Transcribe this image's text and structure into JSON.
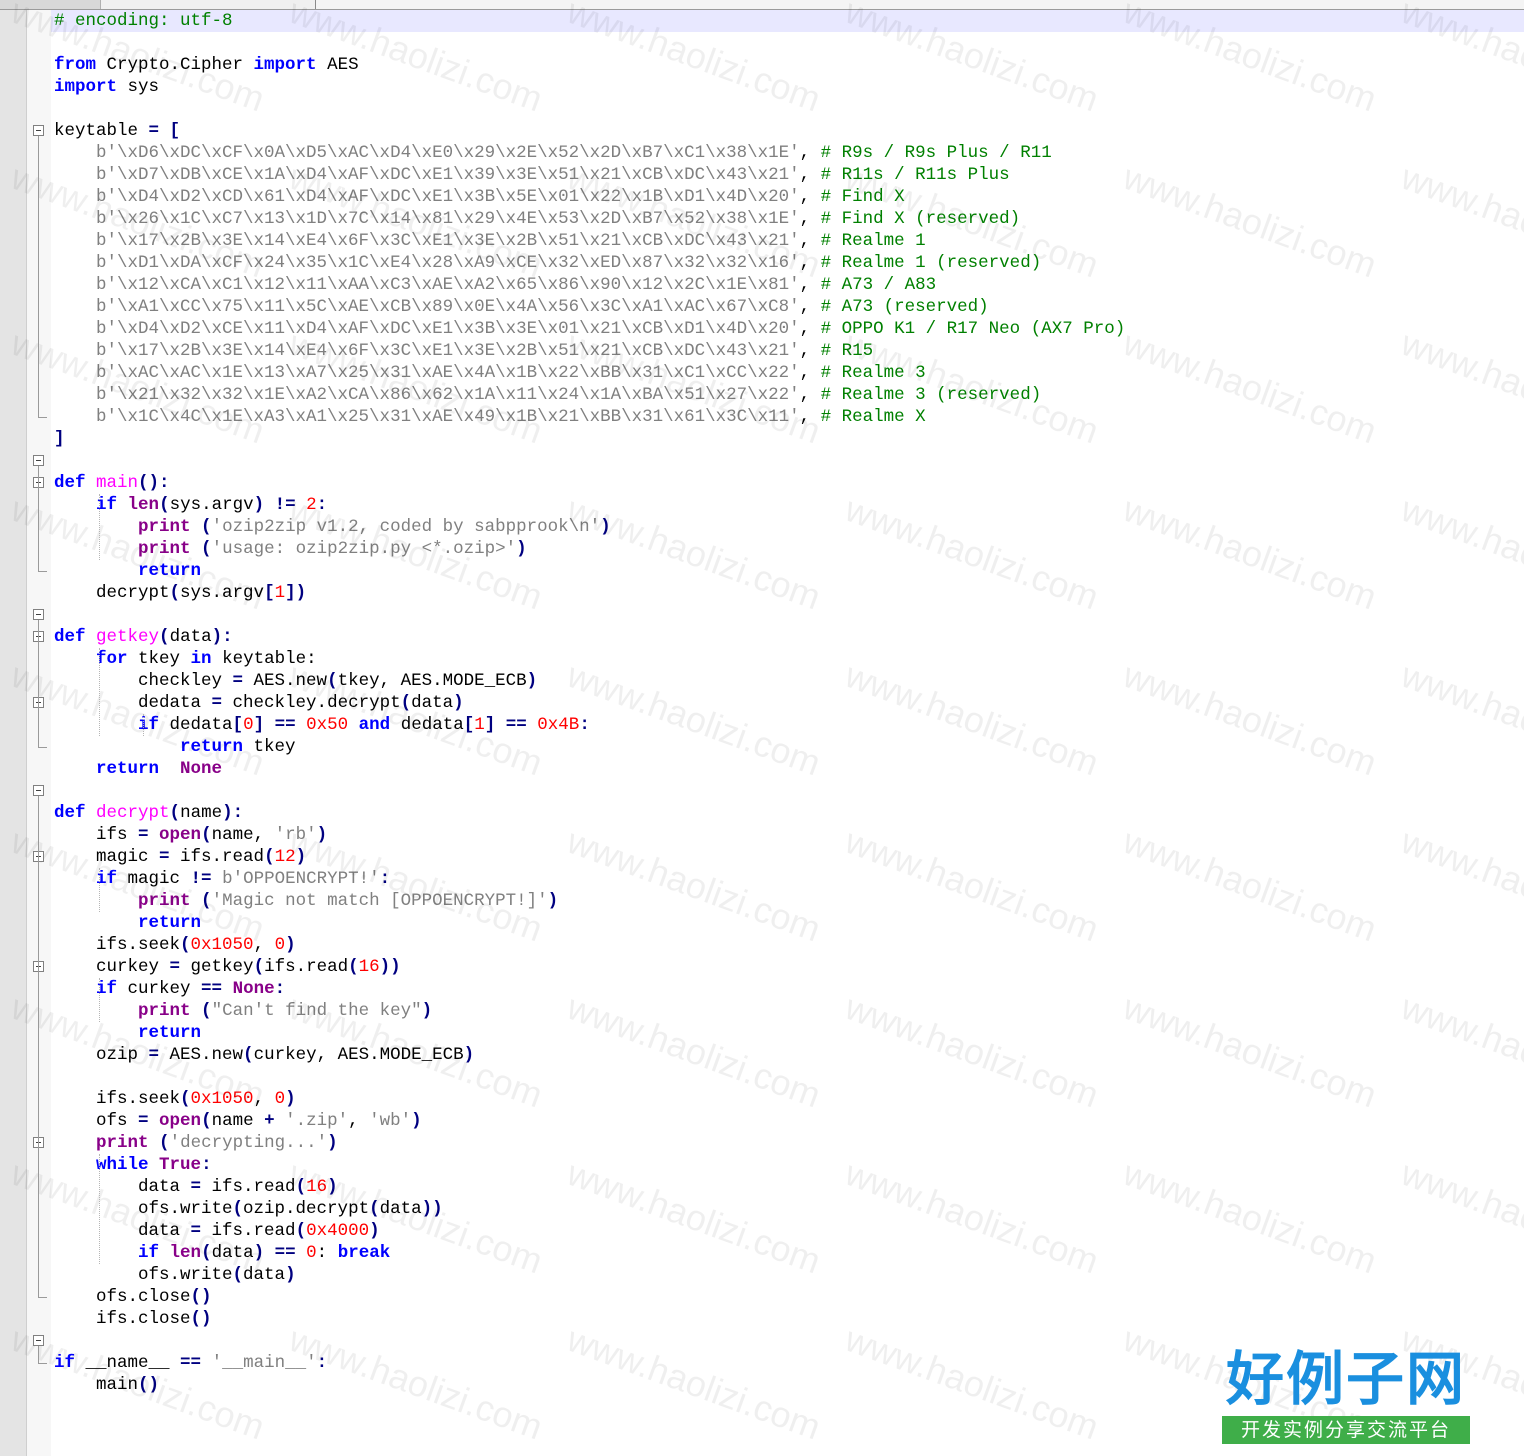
{
  "editor": {
    "lines": [
      [
        {
          "t": "# encoding: utf-8",
          "c": "com"
        }
      ],
      [],
      [
        {
          "t": "from",
          "c": "kw"
        },
        {
          "t": " Crypto.Cipher "
        },
        {
          "t": "import",
          "c": "kw"
        },
        {
          "t": " AES"
        }
      ],
      [
        {
          "t": "import",
          "c": "kw"
        },
        {
          "t": " sys"
        }
      ],
      [],
      [
        {
          "t": "keytable "
        },
        {
          "t": "=",
          "c": "op"
        },
        {
          "t": " "
        },
        {
          "t": "[",
          "c": "op"
        }
      ],
      [
        {
          "t": "    "
        },
        {
          "t": "b'\\xD6\\xDC\\xCF\\x0A\\xD5\\xAC\\xD4\\xE0\\x29\\x2E\\x52\\x2D\\xB7\\xC1\\x38\\x1E'",
          "c": "str"
        },
        {
          "t": ", "
        },
        {
          "t": "# R9s / R9s Plus / R11",
          "c": "com"
        }
      ],
      [
        {
          "t": "    "
        },
        {
          "t": "b'\\xD7\\xDB\\xCE\\x1A\\xD4\\xAF\\xDC\\xE1\\x39\\x3E\\x51\\x21\\xCB\\xDC\\x43\\x21'",
          "c": "str"
        },
        {
          "t": ", "
        },
        {
          "t": "# R11s / R11s Plus",
          "c": "com"
        }
      ],
      [
        {
          "t": "    "
        },
        {
          "t": "b'\\xD4\\xD2\\xCD\\x61\\xD4\\xAF\\xDC\\xE1\\x3B\\x5E\\x01\\x22\\x1B\\xD1\\x4D\\x20'",
          "c": "str"
        },
        {
          "t": ", "
        },
        {
          "t": "# Find X",
          "c": "com"
        }
      ],
      [
        {
          "t": "    "
        },
        {
          "t": "b'\\x26\\x1C\\xC7\\x13\\x1D\\x7C\\x14\\x81\\x29\\x4E\\x53\\x2D\\xB7\\x52\\x38\\x1E'",
          "c": "str"
        },
        {
          "t": ", "
        },
        {
          "t": "# Find X (reserved)",
          "c": "com"
        }
      ],
      [
        {
          "t": "    "
        },
        {
          "t": "b'\\x17\\x2B\\x3E\\x14\\xE4\\x6F\\x3C\\xE1\\x3E\\x2B\\x51\\x21\\xCB\\xDC\\x43\\x21'",
          "c": "str"
        },
        {
          "t": ", "
        },
        {
          "t": "# Realme 1",
          "c": "com"
        }
      ],
      [
        {
          "t": "    "
        },
        {
          "t": "b'\\xD1\\xDA\\xCF\\x24\\x35\\x1C\\xE4\\x28\\xA9\\xCE\\x32\\xED\\x87\\x32\\x32\\x16'",
          "c": "str"
        },
        {
          "t": ", "
        },
        {
          "t": "# Realme 1 (reserved)",
          "c": "com"
        }
      ],
      [
        {
          "t": "    "
        },
        {
          "t": "b'\\x12\\xCA\\xC1\\x12\\x11\\xAA\\xC3\\xAE\\xA2\\x65\\x86\\x90\\x12\\x2C\\x1E\\x81'",
          "c": "str"
        },
        {
          "t": ", "
        },
        {
          "t": "# A73 / A83",
          "c": "com"
        }
      ],
      [
        {
          "t": "    "
        },
        {
          "t": "b'\\xA1\\xCC\\x75\\x11\\x5C\\xAE\\xCB\\x89\\x0E\\x4A\\x56\\x3C\\xA1\\xAC\\x67\\xC8'",
          "c": "str"
        },
        {
          "t": ", "
        },
        {
          "t": "# A73 (reserved)",
          "c": "com"
        }
      ],
      [
        {
          "t": "    "
        },
        {
          "t": "b'\\xD4\\xD2\\xCE\\x11\\xD4\\xAF\\xDC\\xE1\\x3B\\x3E\\x01\\x21\\xCB\\xD1\\x4D\\x20'",
          "c": "str"
        },
        {
          "t": ", "
        },
        {
          "t": "# OPPO K1 / R17 Neo (AX7 Pro)",
          "c": "com"
        }
      ],
      [
        {
          "t": "    "
        },
        {
          "t": "b'\\x17\\x2B\\x3E\\x14\\xE4\\x6F\\x3C\\xE1\\x3E\\x2B\\x51\\x21\\xCB\\xDC\\x43\\x21'",
          "c": "str"
        },
        {
          "t": ", "
        },
        {
          "t": "# R15",
          "c": "com"
        }
      ],
      [
        {
          "t": "    "
        },
        {
          "t": "b'\\xAC\\xAC\\x1E\\x13\\xA7\\x25\\x31\\xAE\\x4A\\x1B\\x22\\xBB\\x31\\xC1\\xCC\\x22'",
          "c": "str"
        },
        {
          "t": ", "
        },
        {
          "t": "# Realme 3",
          "c": "com"
        }
      ],
      [
        {
          "t": "    "
        },
        {
          "t": "b'\\x21\\x32\\x32\\x1E\\xA2\\xCA\\x86\\x62\\x1A\\x11\\x24\\x1A\\xBA\\x51\\x27\\x22'",
          "c": "str"
        },
        {
          "t": ", "
        },
        {
          "t": "# Realme 3 (reserved)",
          "c": "com"
        }
      ],
      [
        {
          "t": "    "
        },
        {
          "t": "b'\\x1C\\x4C\\x1E\\xA3\\xA1\\x25\\x31\\xAE\\x49\\x1B\\x21\\xBB\\x31\\x61\\x3C\\x11'",
          "c": "str"
        },
        {
          "t": ", "
        },
        {
          "t": "# Realme X",
          "c": "com"
        }
      ],
      [
        {
          "t": "]",
          "c": "op"
        }
      ],
      [],
      [
        {
          "t": "def",
          "c": "kw"
        },
        {
          "t": " "
        },
        {
          "t": "main",
          "c": "fn"
        },
        {
          "t": "():",
          "c": "op"
        }
      ],
      [
        {
          "t": "    "
        },
        {
          "t": "if",
          "c": "kw"
        },
        {
          "t": " "
        },
        {
          "t": "len",
          "c": "kw2"
        },
        {
          "t": "(",
          "c": "op"
        },
        {
          "t": "sys.argv"
        },
        {
          "t": ")",
          "c": "op"
        },
        {
          "t": " "
        },
        {
          "t": "!=",
          "c": "op"
        },
        {
          "t": " "
        },
        {
          "t": "2",
          "c": "num"
        },
        {
          "t": ":",
          "c": "op"
        }
      ],
      [
        {
          "t": "        "
        },
        {
          "t": "print",
          "c": "kw2"
        },
        {
          "t": " "
        },
        {
          "t": "(",
          "c": "op"
        },
        {
          "t": "'ozip2zip v1.2, coded by sabpprook\\n'",
          "c": "str"
        },
        {
          "t": ")",
          "c": "op"
        }
      ],
      [
        {
          "t": "        "
        },
        {
          "t": "print",
          "c": "kw2"
        },
        {
          "t": " "
        },
        {
          "t": "(",
          "c": "op"
        },
        {
          "t": "'usage: ozip2zip.py <*.ozip>'",
          "c": "str"
        },
        {
          "t": ")",
          "c": "op"
        }
      ],
      [
        {
          "t": "        "
        },
        {
          "t": "return",
          "c": "kw"
        }
      ],
      [
        {
          "t": "    decrypt"
        },
        {
          "t": "(",
          "c": "op"
        },
        {
          "t": "sys.argv"
        },
        {
          "t": "[",
          "c": "op"
        },
        {
          "t": "1",
          "c": "num"
        },
        {
          "t": "])",
          "c": "op"
        }
      ],
      [],
      [
        {
          "t": "def",
          "c": "kw"
        },
        {
          "t": " "
        },
        {
          "t": "getkey",
          "c": "fn"
        },
        {
          "t": "(",
          "c": "op"
        },
        {
          "t": "data"
        },
        {
          "t": "):",
          "c": "op"
        }
      ],
      [
        {
          "t": "    "
        },
        {
          "t": "for",
          "c": "kw"
        },
        {
          "t": " tkey "
        },
        {
          "t": "in",
          "c": "kw"
        },
        {
          "t": " keytable:"
        }
      ],
      [
        {
          "t": "        checkley "
        },
        {
          "t": "=",
          "c": "op"
        },
        {
          "t": " AES.new"
        },
        {
          "t": "(",
          "c": "op"
        },
        {
          "t": "tkey, AES.MODE_ECB"
        },
        {
          "t": ")",
          "c": "op"
        }
      ],
      [
        {
          "t": "        dedata "
        },
        {
          "t": "=",
          "c": "op"
        },
        {
          "t": " checkley.decrypt"
        },
        {
          "t": "(",
          "c": "op"
        },
        {
          "t": "data"
        },
        {
          "t": ")",
          "c": "op"
        }
      ],
      [
        {
          "t": "        "
        },
        {
          "t": "if",
          "c": "kw"
        },
        {
          "t": " dedata"
        },
        {
          "t": "[",
          "c": "op"
        },
        {
          "t": "0",
          "c": "num"
        },
        {
          "t": "]",
          "c": "op"
        },
        {
          "t": " "
        },
        {
          "t": "==",
          "c": "op"
        },
        {
          "t": " "
        },
        {
          "t": "0x50",
          "c": "num"
        },
        {
          "t": " "
        },
        {
          "t": "and",
          "c": "kw"
        },
        {
          "t": " dedata"
        },
        {
          "t": "[",
          "c": "op"
        },
        {
          "t": "1",
          "c": "num"
        },
        {
          "t": "]",
          "c": "op"
        },
        {
          "t": " "
        },
        {
          "t": "==",
          "c": "op"
        },
        {
          "t": " "
        },
        {
          "t": "0x4B",
          "c": "num"
        },
        {
          "t": ":",
          "c": "op"
        }
      ],
      [
        {
          "t": "            "
        },
        {
          "t": "return",
          "c": "kw"
        },
        {
          "t": " tkey"
        }
      ],
      [
        {
          "t": "    "
        },
        {
          "t": "return",
          "c": "kw"
        },
        {
          "t": "  "
        },
        {
          "t": "None",
          "c": "kw2"
        }
      ],
      [],
      [
        {
          "t": "def",
          "c": "kw"
        },
        {
          "t": " "
        },
        {
          "t": "decrypt",
          "c": "fn"
        },
        {
          "t": "(",
          "c": "op"
        },
        {
          "t": "name"
        },
        {
          "t": "):",
          "c": "op"
        }
      ],
      [
        {
          "t": "    ifs "
        },
        {
          "t": "=",
          "c": "op"
        },
        {
          "t": " "
        },
        {
          "t": "open",
          "c": "kw2"
        },
        {
          "t": "(",
          "c": "op"
        },
        {
          "t": "name, "
        },
        {
          "t": "'rb'",
          "c": "str"
        },
        {
          "t": ")",
          "c": "op"
        }
      ],
      [
        {
          "t": "    magic "
        },
        {
          "t": "=",
          "c": "op"
        },
        {
          "t": " ifs.read"
        },
        {
          "t": "(",
          "c": "op"
        },
        {
          "t": "12",
          "c": "num"
        },
        {
          "t": ")",
          "c": "op"
        }
      ],
      [
        {
          "t": "    "
        },
        {
          "t": "if",
          "c": "kw"
        },
        {
          "t": " magic "
        },
        {
          "t": "!=",
          "c": "op"
        },
        {
          "t": " "
        },
        {
          "t": "b'OPPOENCRYPT!'",
          "c": "str"
        },
        {
          "t": ":",
          "c": "op"
        }
      ],
      [
        {
          "t": "        "
        },
        {
          "t": "print",
          "c": "kw2"
        },
        {
          "t": " "
        },
        {
          "t": "(",
          "c": "op"
        },
        {
          "t": "'Magic not match [OPPOENCRYPT!]'",
          "c": "str"
        },
        {
          "t": ")",
          "c": "op"
        }
      ],
      [
        {
          "t": "        "
        },
        {
          "t": "return",
          "c": "kw"
        }
      ],
      [
        {
          "t": "    ifs.seek"
        },
        {
          "t": "(",
          "c": "op"
        },
        {
          "t": "0x1050",
          "c": "num"
        },
        {
          "t": ", "
        },
        {
          "t": "0",
          "c": "num"
        },
        {
          "t": ")",
          "c": "op"
        }
      ],
      [
        {
          "t": "    curkey "
        },
        {
          "t": "=",
          "c": "op"
        },
        {
          "t": " getkey"
        },
        {
          "t": "(",
          "c": "op"
        },
        {
          "t": "ifs.read"
        },
        {
          "t": "(",
          "c": "op"
        },
        {
          "t": "16",
          "c": "num"
        },
        {
          "t": "))",
          "c": "op"
        }
      ],
      [
        {
          "t": "    "
        },
        {
          "t": "if",
          "c": "kw"
        },
        {
          "t": " curkey "
        },
        {
          "t": "==",
          "c": "op"
        },
        {
          "t": " "
        },
        {
          "t": "None",
          "c": "kw2"
        },
        {
          "t": ":",
          "c": "op"
        }
      ],
      [
        {
          "t": "        "
        },
        {
          "t": "print",
          "c": "kw2"
        },
        {
          "t": " "
        },
        {
          "t": "(",
          "c": "op"
        },
        {
          "t": "\"Can't find the key\"",
          "c": "str"
        },
        {
          "t": ")",
          "c": "op"
        }
      ],
      [
        {
          "t": "        "
        },
        {
          "t": "return",
          "c": "kw"
        }
      ],
      [
        {
          "t": "    ozip "
        },
        {
          "t": "=",
          "c": "op"
        },
        {
          "t": " AES.new"
        },
        {
          "t": "(",
          "c": "op"
        },
        {
          "t": "curkey, AES.MODE_ECB"
        },
        {
          "t": ")",
          "c": "op"
        }
      ],
      [],
      [
        {
          "t": "    ifs.seek"
        },
        {
          "t": "(",
          "c": "op"
        },
        {
          "t": "0x1050",
          "c": "num"
        },
        {
          "t": ", "
        },
        {
          "t": "0",
          "c": "num"
        },
        {
          "t": ")",
          "c": "op"
        }
      ],
      [
        {
          "t": "    ofs "
        },
        {
          "t": "=",
          "c": "op"
        },
        {
          "t": " "
        },
        {
          "t": "open",
          "c": "kw2"
        },
        {
          "t": "(",
          "c": "op"
        },
        {
          "t": "name "
        },
        {
          "t": "+",
          "c": "op"
        },
        {
          "t": " "
        },
        {
          "t": "'.zip'",
          "c": "str"
        },
        {
          "t": ", "
        },
        {
          "t": "'wb'",
          "c": "str"
        },
        {
          "t": ")",
          "c": "op"
        }
      ],
      [
        {
          "t": "    "
        },
        {
          "t": "print",
          "c": "kw2"
        },
        {
          "t": " "
        },
        {
          "t": "(",
          "c": "op"
        },
        {
          "t": "'decrypting...'",
          "c": "str"
        },
        {
          "t": ")",
          "c": "op"
        }
      ],
      [
        {
          "t": "    "
        },
        {
          "t": "while",
          "c": "kw"
        },
        {
          "t": " "
        },
        {
          "t": "True",
          "c": "kw2"
        },
        {
          "t": ":",
          "c": "op"
        }
      ],
      [
        {
          "t": "        data "
        },
        {
          "t": "=",
          "c": "op"
        },
        {
          "t": " ifs.read"
        },
        {
          "t": "(",
          "c": "op"
        },
        {
          "t": "16",
          "c": "num"
        },
        {
          "t": ")",
          "c": "op"
        }
      ],
      [
        {
          "t": "        ofs.write"
        },
        {
          "t": "(",
          "c": "op"
        },
        {
          "t": "ozip.decrypt"
        },
        {
          "t": "(",
          "c": "op"
        },
        {
          "t": "data"
        },
        {
          "t": "))",
          "c": "op"
        }
      ],
      [
        {
          "t": "        data "
        },
        {
          "t": "=",
          "c": "op"
        },
        {
          "t": " ifs.read"
        },
        {
          "t": "(",
          "c": "op"
        },
        {
          "t": "0x4000",
          "c": "num"
        },
        {
          "t": ")",
          "c": "op"
        }
      ],
      [
        {
          "t": "        "
        },
        {
          "t": "if",
          "c": "kw"
        },
        {
          "t": " "
        },
        {
          "t": "len",
          "c": "kw2"
        },
        {
          "t": "(",
          "c": "op"
        },
        {
          "t": "data"
        },
        {
          "t": ")",
          "c": "op"
        },
        {
          "t": " "
        },
        {
          "t": "==",
          "c": "op"
        },
        {
          "t": " "
        },
        {
          "t": "0",
          "c": "num"
        },
        {
          "t": ": "
        },
        {
          "t": "break",
          "c": "kw"
        }
      ],
      [
        {
          "t": "        ofs.write"
        },
        {
          "t": "(",
          "c": "op"
        },
        {
          "t": "data"
        },
        {
          "t": ")",
          "c": "op"
        }
      ],
      [
        {
          "t": "    ofs.close"
        },
        {
          "t": "()",
          "c": "op"
        }
      ],
      [
        {
          "t": "    ifs.close"
        },
        {
          "t": "()",
          "c": "op"
        }
      ],
      [],
      [
        {
          "t": "if",
          "c": "kw"
        },
        {
          "t": " __name__ "
        },
        {
          "t": "==",
          "c": "op"
        },
        {
          "t": " "
        },
        {
          "t": "'__main__'",
          "c": "str"
        },
        {
          "t": ":",
          "c": "op"
        }
      ],
      [
        {
          "t": "    main"
        },
        {
          "t": "()",
          "c": "op"
        }
      ]
    ]
  },
  "watermark": {
    "text": "www.haolizi.com"
  },
  "logo": {
    "main": "好例子网",
    "sub": "开发实例分享交流平台"
  },
  "colors": {
    "keyword": "#0000ff",
    "builtin": "#880088",
    "function": "#ff00ff",
    "string": "#808080",
    "number": "#ff0000",
    "comment": "#008000",
    "operator": "#000080",
    "current_line": "#e8e8ff",
    "logo_blue": "#1a8fdf",
    "logo_green": "#3fae49"
  }
}
